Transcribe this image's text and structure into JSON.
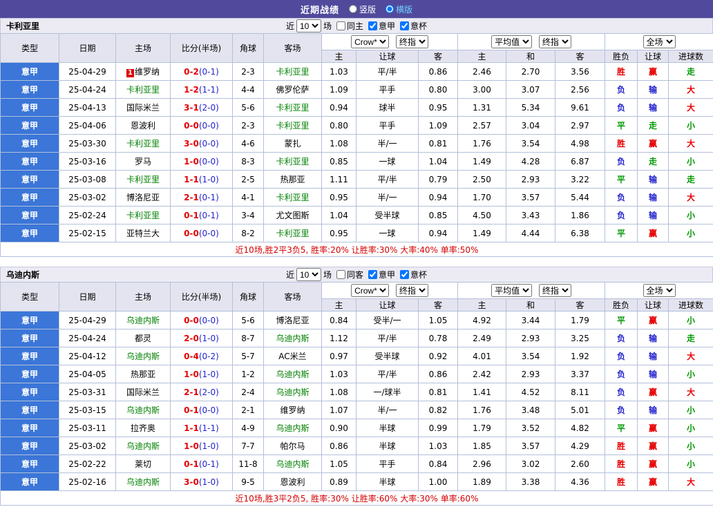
{
  "topbar": {
    "title": "近期战绩",
    "views": [
      {
        "label": "竖版",
        "selected": false
      },
      {
        "label": "横版",
        "selected": true
      }
    ]
  },
  "filter_labels": {
    "near": "近",
    "count": "10",
    "games": "场"
  },
  "header": {
    "cols": [
      "类型",
      "日期",
      "主场",
      "比分(半场)",
      "角球",
      "客场"
    ],
    "sub": [
      "主",
      "让球",
      "客",
      "主",
      "和",
      "客",
      "胜负",
      "让球",
      "进球数"
    ],
    "select_bookmaker": "Crow*",
    "select_final1": "终指",
    "select_average": "平均值",
    "select_final2": "终指",
    "select_scope": "全场"
  },
  "sections": [
    {
      "team": "卡利亚里",
      "checkboxes": [
        {
          "label": "同主",
          "checked": false
        },
        {
          "label": "意甲",
          "checked": true
        },
        {
          "label": "意杯",
          "checked": true
        }
      ],
      "summary": "近10场,胜2平3负5, 胜率:20% 让胜率:30% 大率:40% 单率:50%",
      "rows": [
        {
          "league": "意甲",
          "date": "25-04-29",
          "home": "维罗纳",
          "home_focus": false,
          "badge": "1",
          "score": "0-2",
          "half": "(0-1)",
          "corners": "2-3",
          "away": "卡利亚里",
          "away_focus": true,
          "asia": [
            "1.03",
            "平/半",
            "0.86"
          ],
          "euro": [
            "2.46",
            "2.70",
            "3.56"
          ],
          "results": [
            [
              "胜",
              "r"
            ],
            [
              "赢",
              "r"
            ],
            [
              "走",
              "g"
            ]
          ]
        },
        {
          "league": "意甲",
          "date": "25-04-24",
          "home": "卡利亚里",
          "home_focus": true,
          "score": "1-2",
          "half": "(1-1)",
          "corners": "4-4",
          "away": "佛罗伦萨",
          "away_focus": false,
          "asia": [
            "1.09",
            "平手",
            "0.80"
          ],
          "euro": [
            "3.00",
            "3.07",
            "2.56"
          ],
          "results": [
            [
              "负",
              "b"
            ],
            [
              "输",
              "b"
            ],
            [
              "大",
              "r"
            ]
          ]
        },
        {
          "league": "意甲",
          "date": "25-04-13",
          "home": "国际米兰",
          "home_focus": false,
          "score": "3-1",
          "half": "(2-0)",
          "corners": "5-6",
          "away": "卡利亚里",
          "away_focus": true,
          "asia": [
            "0.94",
            "球半",
            "0.95"
          ],
          "euro": [
            "1.31",
            "5.34",
            "9.61"
          ],
          "results": [
            [
              "负",
              "b"
            ],
            [
              "输",
              "b"
            ],
            [
              "大",
              "r"
            ]
          ]
        },
        {
          "league": "意甲",
          "date": "25-04-06",
          "home": "恩波利",
          "home_focus": false,
          "score": "0-0",
          "half": "(0-0)",
          "corners": "2-3",
          "away": "卡利亚里",
          "away_focus": true,
          "asia": [
            "0.80",
            "平手",
            "1.09"
          ],
          "euro": [
            "2.57",
            "3.04",
            "2.97"
          ],
          "results": [
            [
              "平",
              "g"
            ],
            [
              "走",
              "g"
            ],
            [
              "小",
              "g"
            ]
          ]
        },
        {
          "league": "意甲",
          "date": "25-03-30",
          "home": "卡利亚里",
          "home_focus": true,
          "score": "3-0",
          "half": "(0-0)",
          "corners": "4-6",
          "away": "蒙扎",
          "away_focus": false,
          "asia": [
            "1.08",
            "半/一",
            "0.81"
          ],
          "euro": [
            "1.76",
            "3.54",
            "4.98"
          ],
          "results": [
            [
              "胜",
              "r"
            ],
            [
              "赢",
              "r"
            ],
            [
              "大",
              "r"
            ]
          ]
        },
        {
          "league": "意甲",
          "date": "25-03-16",
          "home": "罗马",
          "home_focus": false,
          "score": "1-0",
          "half": "(0-0)",
          "corners": "8-3",
          "away": "卡利亚里",
          "away_focus": true,
          "asia": [
            "0.85",
            "一球",
            "1.04"
          ],
          "euro": [
            "1.49",
            "4.28",
            "6.87"
          ],
          "results": [
            [
              "负",
              "b"
            ],
            [
              "走",
              "g"
            ],
            [
              "小",
              "g"
            ]
          ]
        },
        {
          "league": "意甲",
          "date": "25-03-08",
          "home": "卡利亚里",
          "home_focus": true,
          "score": "1-1",
          "half": "(1-0)",
          "corners": "2-5",
          "away": "热那亚",
          "away_focus": false,
          "asia": [
            "1.11",
            "平/半",
            "0.79"
          ],
          "euro": [
            "2.50",
            "2.93",
            "3.22"
          ],
          "results": [
            [
              "平",
              "g"
            ],
            [
              "输",
              "b"
            ],
            [
              "走",
              "g"
            ]
          ]
        },
        {
          "league": "意甲",
          "date": "25-03-02",
          "home": "博洛尼亚",
          "home_focus": false,
          "score": "2-1",
          "half": "(0-1)",
          "corners": "4-1",
          "away": "卡利亚里",
          "away_focus": true,
          "asia": [
            "0.95",
            "半/一",
            "0.94"
          ],
          "euro": [
            "1.70",
            "3.57",
            "5.44"
          ],
          "results": [
            [
              "负",
              "b"
            ],
            [
              "输",
              "b"
            ],
            [
              "大",
              "r"
            ]
          ]
        },
        {
          "league": "意甲",
          "date": "25-02-24",
          "home": "卡利亚里",
          "home_focus": true,
          "score": "0-1",
          "half": "(0-1)",
          "corners": "3-4",
          "away": "尤文图斯",
          "away_focus": false,
          "asia": [
            "1.04",
            "受半球",
            "0.85"
          ],
          "euro": [
            "4.50",
            "3.43",
            "1.86"
          ],
          "results": [
            [
              "负",
              "b"
            ],
            [
              "输",
              "b"
            ],
            [
              "小",
              "g"
            ]
          ]
        },
        {
          "league": "意甲",
          "date": "25-02-15",
          "home": "亚特兰大",
          "home_focus": false,
          "score": "0-0",
          "half": "(0-0)",
          "corners": "8-2",
          "away": "卡利亚里",
          "away_focus": true,
          "asia": [
            "0.95",
            "一球",
            "0.94"
          ],
          "euro": [
            "1.49",
            "4.44",
            "6.38"
          ],
          "results": [
            [
              "平",
              "g"
            ],
            [
              "赢",
              "r"
            ],
            [
              "小",
              "g"
            ]
          ]
        }
      ]
    },
    {
      "team": "乌迪内斯",
      "checkboxes": [
        {
          "label": "同客",
          "checked": false
        },
        {
          "label": "意甲",
          "checked": true
        },
        {
          "label": "意杯",
          "checked": true
        }
      ],
      "summary": "近10场,胜3平2负5, 胜率:30% 让胜率:60% 大率:30% 单率:60%",
      "rows": [
        {
          "league": "意甲",
          "date": "25-04-29",
          "home": "乌迪内斯",
          "home_focus": true,
          "score": "0-0",
          "half": "(0-0)",
          "corners": "5-6",
          "away": "博洛尼亚",
          "away_focus": false,
          "asia": [
            "0.84",
            "受半/一",
            "1.05"
          ],
          "euro": [
            "4.92",
            "3.44",
            "1.79"
          ],
          "results": [
            [
              "平",
              "g"
            ],
            [
              "赢",
              "r"
            ],
            [
              "小",
              "g"
            ]
          ]
        },
        {
          "league": "意甲",
          "date": "25-04-24",
          "home": "都灵",
          "home_focus": false,
          "score": "2-0",
          "half": "(1-0)",
          "corners": "8-7",
          "away": "乌迪内斯",
          "away_focus": true,
          "asia": [
            "1.12",
            "平/半",
            "0.78"
          ],
          "euro": [
            "2.49",
            "2.93",
            "3.25"
          ],
          "results": [
            [
              "负",
              "b"
            ],
            [
              "输",
              "b"
            ],
            [
              "走",
              "g"
            ]
          ]
        },
        {
          "league": "意甲",
          "date": "25-04-12",
          "home": "乌迪内斯",
          "home_focus": true,
          "score": "0-4",
          "half": "(0-2)",
          "corners": "5-7",
          "away": "AC米兰",
          "away_focus": false,
          "asia": [
            "0.97",
            "受半球",
            "0.92"
          ],
          "euro": [
            "4.01",
            "3.54",
            "1.92"
          ],
          "results": [
            [
              "负",
              "b"
            ],
            [
              "输",
              "b"
            ],
            [
              "大",
              "r"
            ]
          ]
        },
        {
          "league": "意甲",
          "date": "25-04-05",
          "home": "热那亚",
          "home_focus": false,
          "score": "1-0",
          "half": "(1-0)",
          "corners": "1-2",
          "away": "乌迪内斯",
          "away_focus": true,
          "asia": [
            "1.03",
            "平/半",
            "0.86"
          ],
          "euro": [
            "2.42",
            "2.93",
            "3.37"
          ],
          "results": [
            [
              "负",
              "b"
            ],
            [
              "输",
              "b"
            ],
            [
              "小",
              "g"
            ]
          ]
        },
        {
          "league": "意甲",
          "date": "25-03-31",
          "home": "国际米兰",
          "home_focus": false,
          "score": "2-1",
          "half": "(2-0)",
          "corners": "2-4",
          "away": "乌迪内斯",
          "away_focus": true,
          "asia": [
            "1.08",
            "一/球半",
            "0.81"
          ],
          "euro": [
            "1.41",
            "4.52",
            "8.11"
          ],
          "results": [
            [
              "负",
              "b"
            ],
            [
              "赢",
              "r"
            ],
            [
              "大",
              "r"
            ]
          ]
        },
        {
          "league": "意甲",
          "date": "25-03-15",
          "home": "乌迪内斯",
          "home_focus": true,
          "score": "0-1",
          "half": "(0-0)",
          "corners": "2-1",
          "away": "维罗纳",
          "away_focus": false,
          "asia": [
            "1.07",
            "半/一",
            "0.82"
          ],
          "euro": [
            "1.76",
            "3.48",
            "5.01"
          ],
          "results": [
            [
              "负",
              "b"
            ],
            [
              "输",
              "b"
            ],
            [
              "小",
              "g"
            ]
          ]
        },
        {
          "league": "意甲",
          "date": "25-03-11",
          "home": "拉齐奥",
          "home_focus": false,
          "score": "1-1",
          "half": "(1-1)",
          "corners": "4-9",
          "away": "乌迪内斯",
          "away_focus": true,
          "asia": [
            "0.90",
            "半球",
            "0.99"
          ],
          "euro": [
            "1.79",
            "3.52",
            "4.82"
          ],
          "results": [
            [
              "平",
              "g"
            ],
            [
              "赢",
              "r"
            ],
            [
              "小",
              "g"
            ]
          ]
        },
        {
          "league": "意甲",
          "date": "25-03-02",
          "home": "乌迪内斯",
          "home_focus": true,
          "score": "1-0",
          "half": "(1-0)",
          "corners": "7-7",
          "away": "帕尔马",
          "away_focus": false,
          "asia": [
            "0.86",
            "半球",
            "1.03"
          ],
          "euro": [
            "1.85",
            "3.57",
            "4.29"
          ],
          "results": [
            [
              "胜",
              "r"
            ],
            [
              "赢",
              "r"
            ],
            [
              "小",
              "g"
            ]
          ]
        },
        {
          "league": "意甲",
          "date": "25-02-22",
          "home": "莱切",
          "home_focus": false,
          "score": "0-1",
          "half": "(0-1)",
          "corners": "11-8",
          "away": "乌迪内斯",
          "away_focus": true,
          "asia": [
            "1.05",
            "平手",
            "0.84"
          ],
          "euro": [
            "2.96",
            "3.02",
            "2.60"
          ],
          "results": [
            [
              "胜",
              "r"
            ],
            [
              "赢",
              "r"
            ],
            [
              "小",
              "g"
            ]
          ]
        },
        {
          "league": "意甲",
          "date": "25-02-16",
          "home": "乌迪内斯",
          "home_focus": true,
          "score": "3-0",
          "half": "(1-0)",
          "corners": "9-5",
          "away": "恩波利",
          "away_focus": false,
          "asia": [
            "0.89",
            "半球",
            "1.00"
          ],
          "euro": [
            "1.89",
            "3.38",
            "4.36"
          ],
          "results": [
            [
              "胜",
              "r"
            ],
            [
              "赢",
              "r"
            ],
            [
              "大",
              "r"
            ]
          ]
        }
      ]
    }
  ],
  "colors": {
    "topbar_bg": "#514a9c",
    "league_cell_bg": "#3b76d8",
    "focus_team": "#008000",
    "win_red": "#e60000",
    "draw_green": "#009900",
    "lose_blue": "#2222cc",
    "summary_red": "#d40000"
  }
}
